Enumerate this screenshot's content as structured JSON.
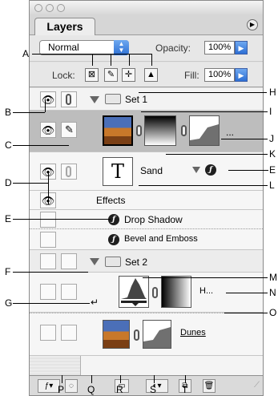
{
  "panel": {
    "tab_label": "Layers",
    "blend_mode": "Normal",
    "opacity_label": "Opacity:",
    "opacity_value": "100%",
    "lock_label": "Lock:",
    "fill_label": "Fill:",
    "fill_value": "100%"
  },
  "layers": {
    "set1_name": "Set 1",
    "sand_layer_name": "Sand",
    "effects_label": "Effects",
    "effect_1": "Drop Shadow",
    "effect_2": "Bevel and Emboss",
    "set2_name": "Set 2",
    "adjust_layer_name": "H...",
    "dunes_layer_name": "Dunes",
    "ellipsis": "..."
  },
  "callouts": {
    "A": "A",
    "B": "B",
    "C": "C",
    "D": "D",
    "E1": "E",
    "E2": "E",
    "F": "F",
    "G": "G",
    "H": "H",
    "I": "I",
    "J": "J",
    "K": "K",
    "L": "L",
    "M": "M",
    "N": "N",
    "O": "O",
    "P": "P",
    "Q": "Q",
    "R": "R",
    "S": "S",
    "T": "T"
  },
  "icons": [
    "eye-icon",
    "link-icon",
    "brush-icon",
    "folder-icon",
    "fx-icon",
    "trash-icon",
    "new-layer-icon",
    "mask-icon",
    "adjustment-icon",
    "lock-icon",
    "move-icon",
    "checker-icon"
  ]
}
